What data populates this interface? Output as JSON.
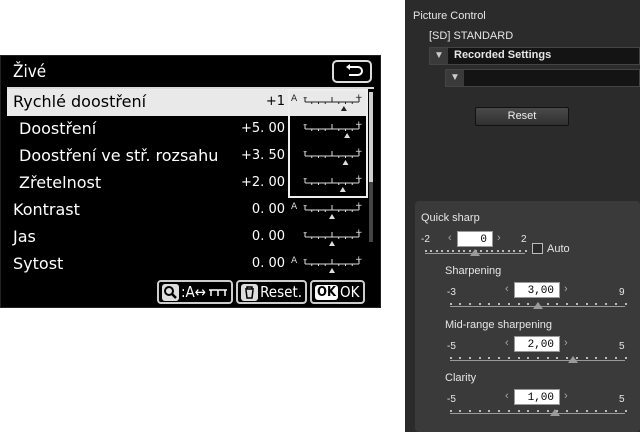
{
  "camera": {
    "title": "Živé",
    "rows": [
      {
        "label": "Rychlé doostření",
        "value": "+1",
        "sub": false,
        "selected": true,
        "auto": true,
        "pos": 0.72
      },
      {
        "label": "Doostření",
        "value": "+5. 00",
        "sub": true,
        "selected": false,
        "auto": false,
        "pos": 0.78
      },
      {
        "label": "Doostření ve stř. rozsahu",
        "value": "+3. 50",
        "sub": true,
        "selected": false,
        "auto": false,
        "pos": 0.75
      },
      {
        "label": "Zřetelnost",
        "value": "+2. 00",
        "sub": true,
        "selected": false,
        "auto": false,
        "pos": 0.7
      },
      {
        "label": "Kontrast",
        "value": "0. 00",
        "sub": false,
        "selected": false,
        "auto": true,
        "pos": 0.5
      },
      {
        "label": "Jas",
        "value": "0. 00",
        "sub": false,
        "selected": false,
        "auto": false,
        "pos": 0.5
      },
      {
        "label": "Sytost",
        "value": "0. 00",
        "sub": false,
        "selected": false,
        "auto": true,
        "pos": 0.5
      }
    ],
    "bottom": {
      "zoom_label": ":A↔",
      "reset_label": "Reset.",
      "ok_icon": "OK",
      "ok_label": "OK"
    }
  },
  "panel": {
    "title": "Picture Control",
    "current": "[SD] STANDARD",
    "dropdown1": "Recorded Settings",
    "dropdown2": "",
    "reset": "Reset",
    "sliders": [
      {
        "label": "Quick sharp",
        "min": "-2",
        "max": "2",
        "value": "0",
        "pos": 0.5,
        "auto_label": "Auto"
      },
      {
        "label": "Sharpening",
        "min": "-3",
        "max": "9",
        "value": "3,00",
        "pos": 0.5
      },
      {
        "label": "Mid-range sharpening",
        "min": "-5",
        "max": "5",
        "value": "2,00",
        "pos": 0.7
      },
      {
        "label": "Clarity",
        "min": "-5",
        "max": "5",
        "value": "1,00",
        "pos": 0.6
      }
    ]
  },
  "colors": {
    "panel_bg": "#2b2b2b",
    "adj_bg": "#3a3a3a",
    "cam_bg": "#000000",
    "selected_row": "#e9e9e9"
  }
}
